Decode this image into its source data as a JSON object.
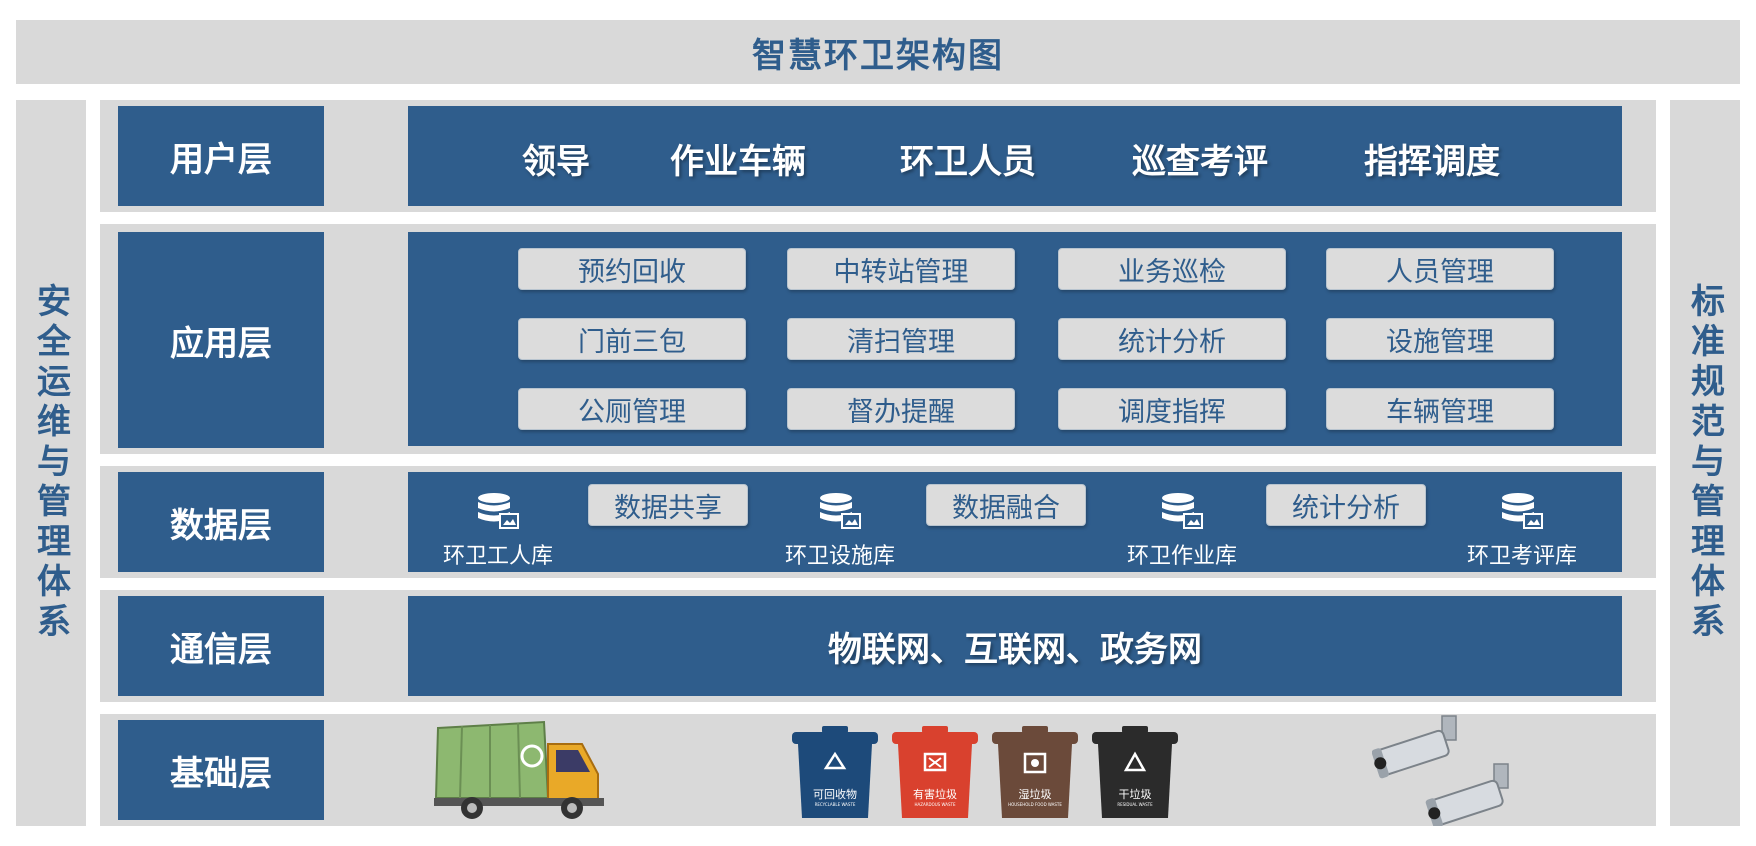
{
  "title": "智慧环卫架构图",
  "left_side": "安全运维与管理体系",
  "right_side": "标准规范与管理体系",
  "layers": {
    "user": {
      "label": "用户层",
      "items": [
        "领导",
        "作业车辆",
        "环卫人员",
        "巡查考评",
        "指挥调度"
      ]
    },
    "application": {
      "label": "应用层",
      "items": [
        "预约回收",
        "中转站管理",
        "业务巡检",
        "人员管理",
        "门前三包",
        "清扫管理",
        "统计分析",
        "设施管理",
        "公厕管理",
        "督办提醒",
        "调度指挥",
        "车辆管理"
      ]
    },
    "data": {
      "label": "数据层",
      "databases": [
        "环卫工人库",
        "环卫设施库",
        "环卫作业库",
        "环卫考评库"
      ],
      "processes": [
        "数据共享",
        "数据融合",
        "统计分析"
      ]
    },
    "communication": {
      "label": "通信层",
      "text": "物联网、互联网、政务网"
    },
    "foundation": {
      "label": "基础层",
      "bins": [
        {
          "label": "可回收物",
          "sub": "RECYCLABLE WASTE",
          "color": "#1d4a7a"
        },
        {
          "label": "有害垃圾",
          "sub": "HAZARDOUS WASTE",
          "color": "#d9412e"
        },
        {
          "label": "湿垃圾",
          "sub": "HOUSEHOLD FOOD WASTE",
          "color": "#6b4a3a"
        },
        {
          "label": "干垃圾",
          "sub": "RESIDUAL WASTE",
          "color": "#2b2b2b"
        }
      ]
    }
  },
  "colors": {
    "primary": "#2f5d8c",
    "background_gray": "#d9d9d9",
    "pill_gray": "#dcdcdc"
  }
}
